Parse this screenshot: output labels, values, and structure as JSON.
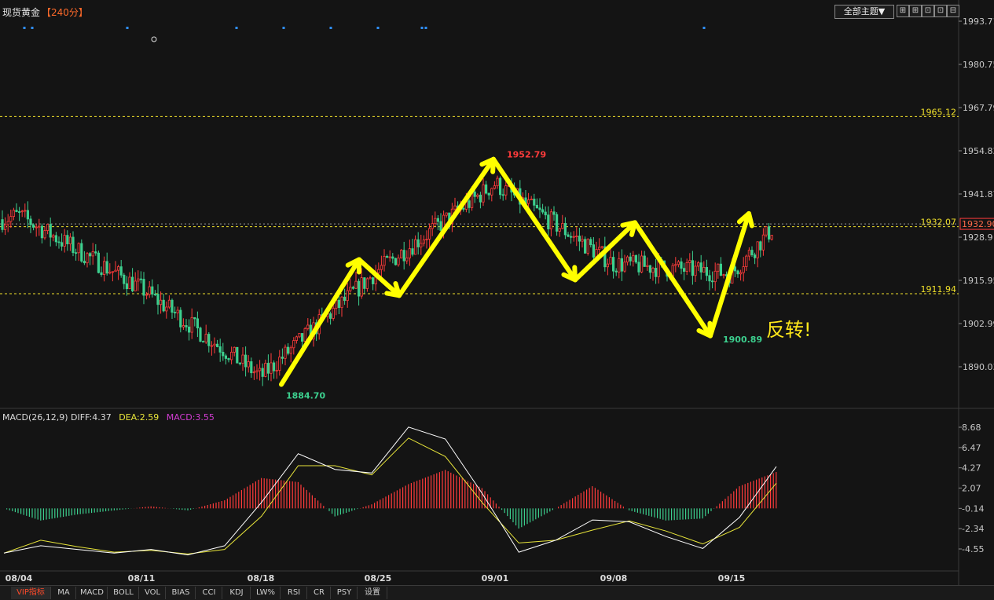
{
  "header": {
    "instrument": "现货黄金",
    "period": "【240分】",
    "theme_button": "全部主题▼",
    "window_buttons": [
      "⊞",
      "⊞",
      "⊡",
      "⊡",
      "⊟"
    ]
  },
  "chart_data": {
    "type": "candlestick",
    "main": {
      "y_ticks": [
        1993.71,
        1980.75,
        1967.79,
        1954.83,
        1941.87,
        1928.91,
        1915.95,
        1902.99,
        1890.03
      ],
      "y_tick_labels": [
        "1993.71",
        "1980.75",
        "1967.79",
        "1954.83",
        "1941.87",
        "1928.9",
        "1915.95",
        "1902.99",
        "1890.03"
      ],
      "reference_lines": [
        {
          "value": 1965.12,
          "label": "1965.12"
        },
        {
          "value": 1932.07,
          "label": "1932.07"
        },
        {
          "value": 1911.94,
          "label": "1911.94"
        }
      ],
      "current_price": {
        "value": 1932.9,
        "label": "1932.90"
      },
      "annotations": [
        {
          "label": "1952.79",
          "value": 1952.79,
          "color": "#ff3b3b"
        },
        {
          "label": "1884.70",
          "value": 1884.7,
          "color": "#3ccf8e"
        },
        {
          "label": "1900.89",
          "value": 1900.89,
          "color": "#3ccf8e"
        }
      ],
      "note_text": "反转!",
      "price_path": [
        {
          "date": "08/04",
          "open": 1936,
          "close": 1935
        },
        {
          "date": "08/11",
          "open": 1915,
          "close": 1912
        },
        {
          "date": "08/18",
          "open": 1888,
          "close": 1886
        },
        {
          "date": "08/25",
          "open": 1918,
          "close": 1920
        },
        {
          "date": "09/01",
          "open": 1946,
          "close": 1944
        },
        {
          "date": "09/08",
          "open": 1920,
          "close": 1922
        },
        {
          "date": "09/15",
          "open": 1912,
          "close": 1924
        }
      ],
      "trend_arrows": [
        {
          "from": 1884.7,
          "to": 1922.2
        },
        {
          "from": 1922.2,
          "to": 1911.4
        },
        {
          "from": 1911.4,
          "to": 1952.3
        },
        {
          "from": 1952.3,
          "to": 1916.1
        },
        {
          "from": 1916.1,
          "to": 1933.3
        },
        {
          "from": 1933.3,
          "to": 1899.3
        },
        {
          "from": 1899.3,
          "to": 1936.0
        }
      ]
    },
    "macd": {
      "title": "MACD(26,12,9)",
      "diff": "DIFF:4.37",
      "dea": "DEA:2.59",
      "macd": "MACD:3.55",
      "y_ticks": [
        8.68,
        6.47,
        4.27,
        2.07,
        -0.14,
        -2.34,
        -4.55
      ],
      "y_tick_labels": [
        "8.68",
        "6.47",
        "4.27",
        "2.07",
        "-0.14",
        "-2.34",
        "-4.55"
      ],
      "diff_path": [
        -5.0,
        -4.2,
        -4.6,
        -5.0,
        -4.6,
        -5.2,
        -4.2,
        0.5,
        5.8,
        4.1,
        3.7,
        8.7,
        7.4,
        1.5,
        -4.9,
        -3.6,
        -1.4,
        -1.6,
        -3.2,
        -4.5,
        -1.1,
        4.4
      ],
      "dea_path": [
        -5.0,
        -3.6,
        -4.3,
        -4.9,
        -4.7,
        -5.1,
        -4.6,
        -1.0,
        4.5,
        4.5,
        3.5,
        7.5,
        5.5,
        0.5,
        -3.9,
        -3.6,
        -2.5,
        -1.5,
        -2.6,
        -4.0,
        -2.2,
        2.6
      ]
    },
    "x_labels": [
      "08/04",
      "08/11",
      "08/18",
      "08/25",
      "09/01",
      "09/08",
      "09/15"
    ]
  },
  "bottom_tabs": [
    "VIP指标",
    "MA",
    "MACD",
    "BOLL",
    "VOL",
    "BIAS",
    "CCI",
    "KDJ",
    "LW%",
    "RSI",
    "CR",
    "PSY",
    "设置"
  ],
  "colors": {
    "up": "#ff3b3b",
    "down": "#3ccf8e",
    "arrow": "#ffff00",
    "ref_line": "#f0e02a",
    "diff": "#ffffff",
    "dea": "#e8e53a"
  }
}
